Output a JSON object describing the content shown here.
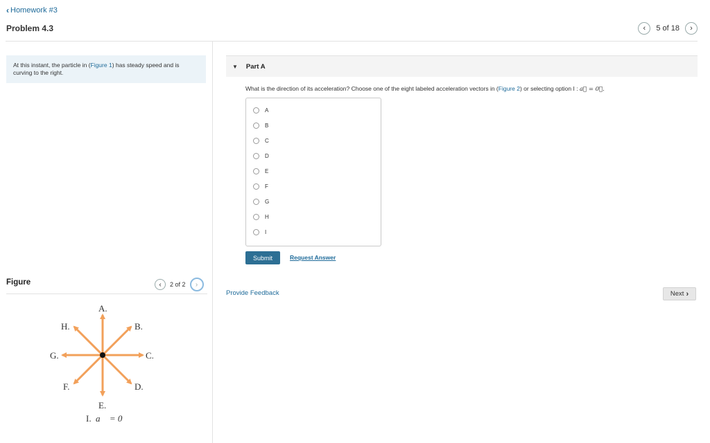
{
  "nav": {
    "back_label": "Homework #3"
  },
  "problem": {
    "title": "Problem 4.3"
  },
  "pager": {
    "text": "5 of 18"
  },
  "intro": {
    "text_before": "At this instant, the particle in (",
    "figure_link": "Figure 1",
    "text_after": ") has steady speed and is curving to the right."
  },
  "figure": {
    "title": "Figure",
    "pager_text": "2 of 2",
    "labels": {
      "A": "A.",
      "B": "B.",
      "C": "C.",
      "D": "D.",
      "E": "E.",
      "F": "F.",
      "G": "G.",
      "H": "H.",
      "I_prefix": "I.",
      "I_eq": "a⃗ = 0⃗"
    },
    "arrow_color": "#f2a05a"
  },
  "part": {
    "label": "Part A",
    "question_before": "What is the direction of its acceleration? Choose one of the eight labeled acceleration vectors in (",
    "question_link": "Figure 2",
    "question_after": ") or selecting option I : ",
    "question_math": "a⃗ = 0⃗.",
    "options": [
      "A",
      "B",
      "C",
      "D",
      "E",
      "F",
      "G",
      "H",
      "I"
    ]
  },
  "actions": {
    "submit": "Submit",
    "request_answer": "Request Answer",
    "provide_feedback": "Provide Feedback",
    "next": "Next"
  },
  "colors": {
    "accent": "#2d6f94",
    "link": "#1f6b9a",
    "intro_bg": "#ebf3f8"
  }
}
